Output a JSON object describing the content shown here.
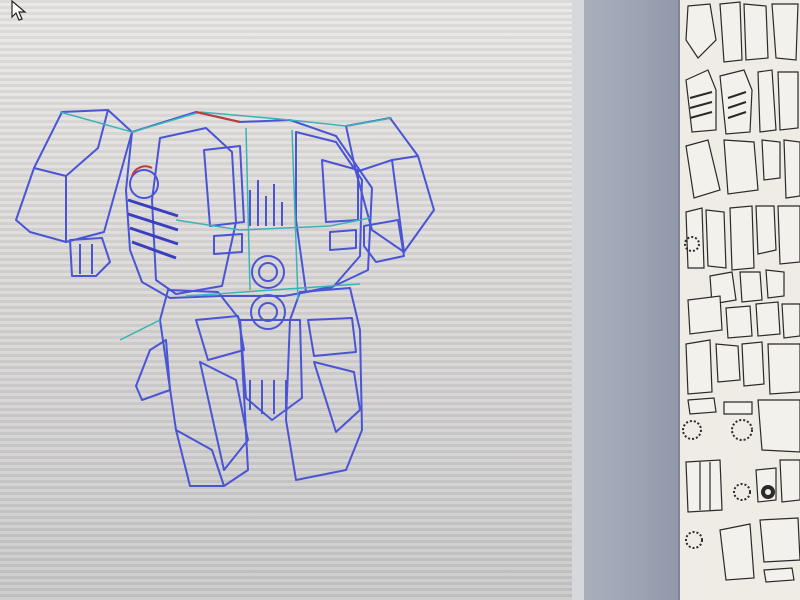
{
  "app": {
    "panels": [
      "3d-viewport",
      "unfold-viewport"
    ],
    "model": "robot-torso-wireframe"
  },
  "colors": {
    "wire_blue": "#4a55d6",
    "wire_teal": "#3bb3b5",
    "wire_red": "#c23a3a",
    "paper": "#efece6",
    "part_outline": "#2a2a2a"
  },
  "icons": {
    "cursor": "arrow-cursor-icon",
    "gear": "gear-part-icon"
  }
}
